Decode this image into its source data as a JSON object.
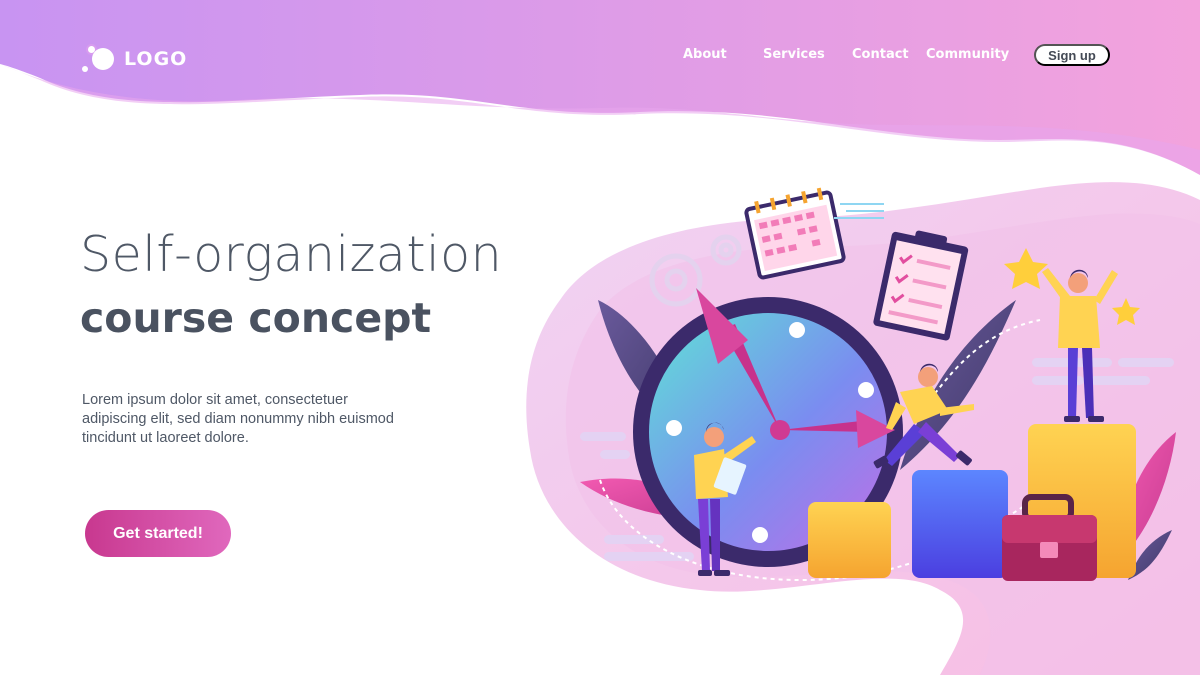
{
  "header": {
    "logo_text": "LOGO",
    "nav": [
      {
        "label": "About"
      },
      {
        "label": "Services"
      },
      {
        "label": "Contact"
      },
      {
        "label": "Community"
      }
    ],
    "signup_label": "Sign up"
  },
  "hero": {
    "title": "Self-organization",
    "subtitle": "course concept",
    "description": "Lorem ipsum dolor sit amet, consectetuer adipiscing elit, sed diam nonummy nibh euismod tincidunt ut laoreet dolore.",
    "cta_label": "Get started!"
  },
  "colors": {
    "header_gradient_start": "#c894f2",
    "header_gradient_end": "#f3a3dd",
    "accent": "#d23f97",
    "text": "#4f5866"
  },
  "illustration": {
    "icons": [
      "clock-icon",
      "calendar-icon",
      "clipboard-checklist-icon",
      "gear-icon",
      "star-icon",
      "briefcase-icon",
      "person-icon",
      "bar-chart-icon"
    ]
  }
}
